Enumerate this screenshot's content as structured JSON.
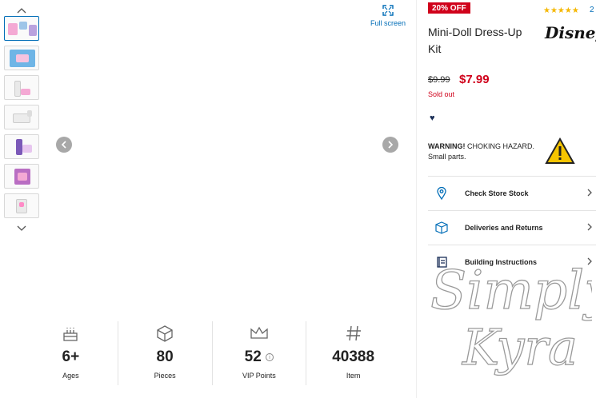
{
  "gallery": {
    "thumbnails": [
      {
        "label": "thumb-1",
        "active": true
      },
      {
        "label": "thumb-2",
        "active": false
      },
      {
        "label": "thumb-3",
        "active": false
      },
      {
        "label": "thumb-4",
        "active": false
      },
      {
        "label": "thumb-5",
        "active": false
      },
      {
        "label": "thumb-6",
        "active": false
      },
      {
        "label": "thumb-7",
        "active": false
      }
    ],
    "fullscreen_label": "Full screen"
  },
  "stats": [
    {
      "icon": "cake-icon",
      "value": "6+",
      "label": "Ages"
    },
    {
      "icon": "brick-icon",
      "value": "80",
      "label": "Pieces"
    },
    {
      "icon": "crown-icon",
      "value": "52",
      "label": "VIP Points",
      "info": "i"
    },
    {
      "icon": "hash-icon",
      "value": "40388",
      "label": "Item"
    }
  ],
  "product": {
    "badge": "20% OFF",
    "rating_stars": "★★★★★",
    "review_count": "2",
    "brand": "Disney",
    "title": "Mini-Doll Dress-Up Kit",
    "old_price": "$9.99",
    "price": "$7.99",
    "status": "Sold out",
    "heart": "♥",
    "warning_bold": "WARNING!",
    "warning_text": " CHOKING HAZARD. Small parts."
  },
  "links": [
    {
      "icon": "location-pin-icon",
      "label": "Check Store Stock"
    },
    {
      "icon": "box-icon",
      "label": "Deliveries and Returns"
    },
    {
      "icon": "book-icon",
      "label": "Building Instructions"
    }
  ],
  "watermark": {
    "line1": "Simply",
    "line2": "Kyra"
  },
  "colors": {
    "accent": "#006db7",
    "sale": "#d0021b",
    "star": "#f5b700"
  }
}
